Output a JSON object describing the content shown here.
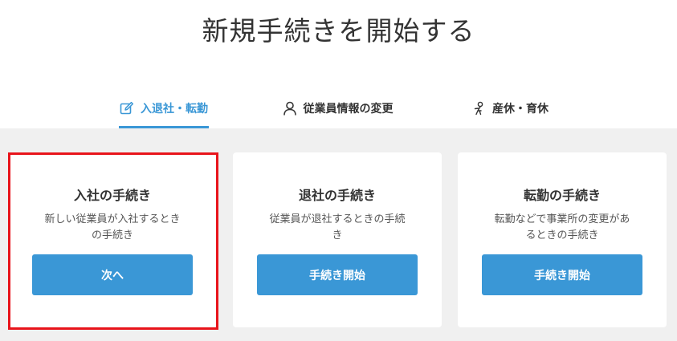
{
  "page": {
    "title": "新規手続きを開始する"
  },
  "tabs": [
    {
      "label": "入退社・転勤",
      "icon": "edit-icon",
      "active": true
    },
    {
      "label": "従業員情報の変更",
      "icon": "person-icon",
      "active": false
    },
    {
      "label": "産休・育休",
      "icon": "baby-icon",
      "active": false
    }
  ],
  "cards": [
    {
      "title": "入社の手続き",
      "desc_line1": "新しい従業員が入社するとき",
      "desc_line2": "の手続き",
      "button": "次へ"
    },
    {
      "title": "退社の手続き",
      "desc_line1": "従業員が退社するときの手続",
      "desc_line2": "き",
      "button": "手続き開始"
    },
    {
      "title": "転勤の手続き",
      "desc_line1": "転勤などで事業所の変更があ",
      "desc_line2": "るときの手続き",
      "button": "手続き開始"
    }
  ],
  "colors": {
    "accent": "#3a97d6",
    "highlight": "#e8141b",
    "panel_bg": "#f0f0f0"
  }
}
